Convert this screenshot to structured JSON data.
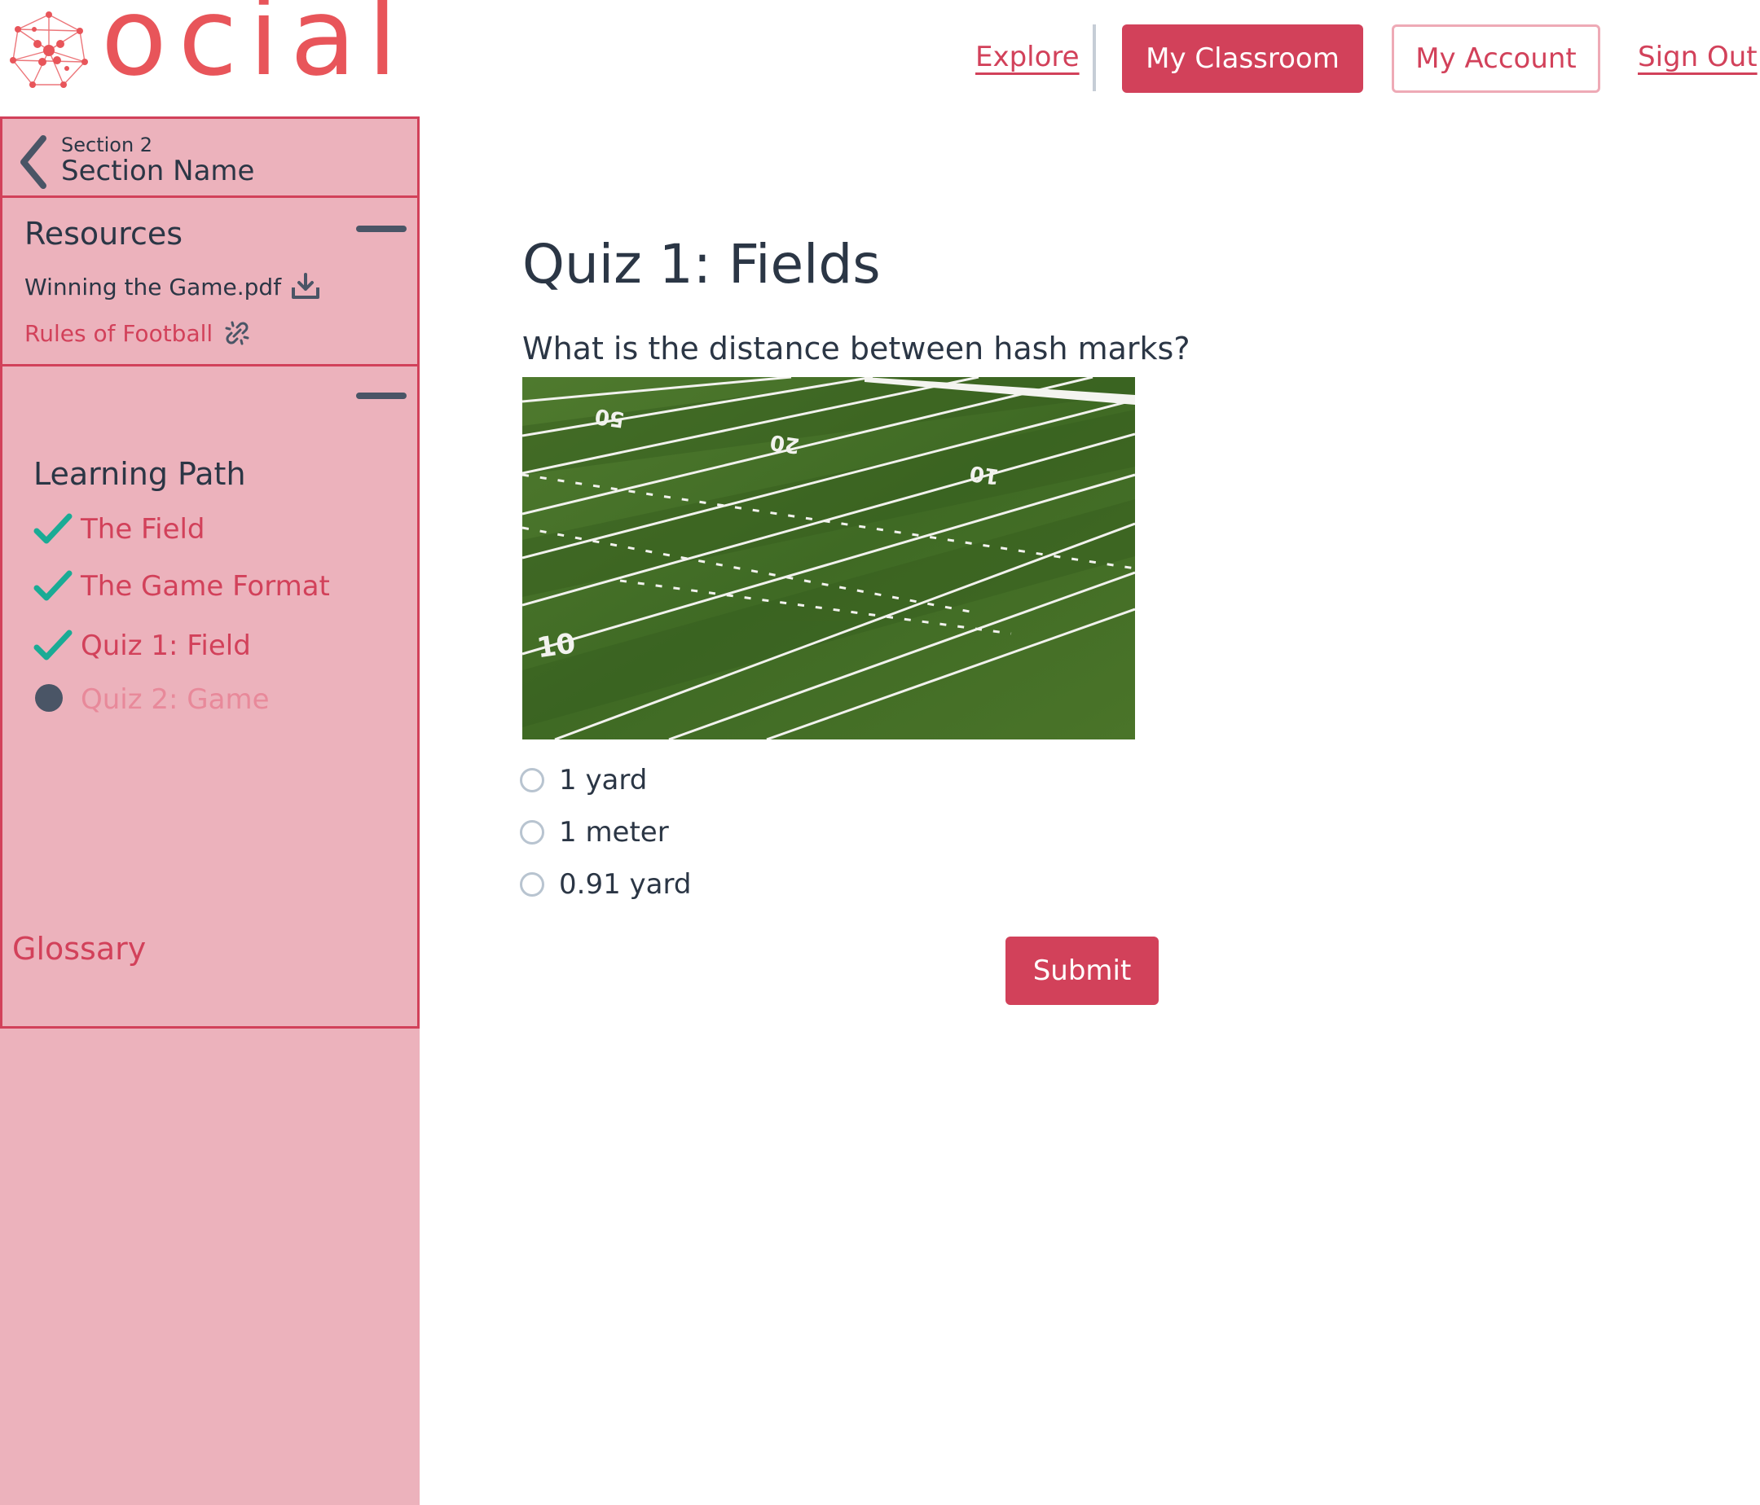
{
  "brand": {
    "wordmark": "ocial"
  },
  "nav": {
    "explore": "Explore",
    "my_classroom": "My Classroom",
    "my_account": "My Account",
    "sign_out": "Sign Out"
  },
  "sidebar": {
    "section": {
      "label": "Section 2",
      "name": "Section Name"
    },
    "resources": {
      "title": "Resources",
      "items": [
        {
          "label": "Winning the Game.pdf",
          "icon": "download-icon"
        },
        {
          "label": "Rules of Football",
          "icon": "link-icon"
        }
      ]
    },
    "learning_path": {
      "title": "Learning Path",
      "items": [
        {
          "label": "The Field",
          "status": "done"
        },
        {
          "label": "The Game Format",
          "status": "done"
        },
        {
          "label": "Quiz 1: Field",
          "status": "done"
        },
        {
          "label": "Quiz 2: Game",
          "status": "current"
        }
      ]
    },
    "glossary": "Glossary"
  },
  "quiz": {
    "title": "Quiz 1: Fields",
    "question": "What is the distance between hash marks?",
    "image": {
      "yard_labels": [
        "50",
        "20",
        "10",
        "10"
      ]
    },
    "options": [
      "1 yard",
      "1 meter",
      "0.91 yard"
    ],
    "submit": "Submit"
  },
  "colors": {
    "accent": "#d2415a",
    "sidebar_bg": "#ecb2bc",
    "logo": "#e8555a",
    "check": "#1aab95",
    "text": "#2b3645"
  }
}
